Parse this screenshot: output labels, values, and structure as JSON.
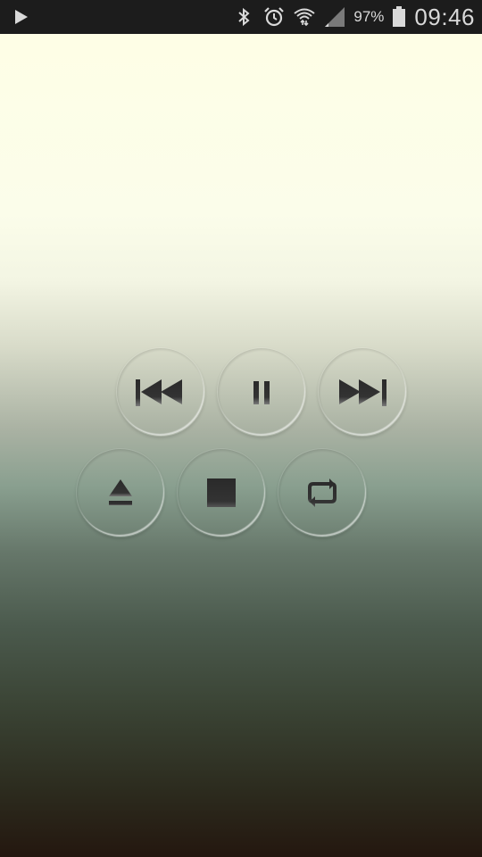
{
  "status_bar": {
    "battery_percent": "97%",
    "time": "09:46",
    "icons": [
      "play-indicator-icon",
      "bluetooth-icon",
      "alarm-icon",
      "wifi-icon",
      "signal-icon",
      "battery-icon"
    ]
  },
  "player": {
    "controls_row1": [
      "previous-track-button",
      "pause-button",
      "next-track-button"
    ],
    "controls_row2": [
      "eject-button",
      "stop-button",
      "repeat-button"
    ],
    "icon_color": "#2b2b2b"
  },
  "theme": {
    "gradient_top": "#fefee6",
    "gradient_bottom": "#24170f",
    "statusbar_bg": "#1c1c1c"
  }
}
